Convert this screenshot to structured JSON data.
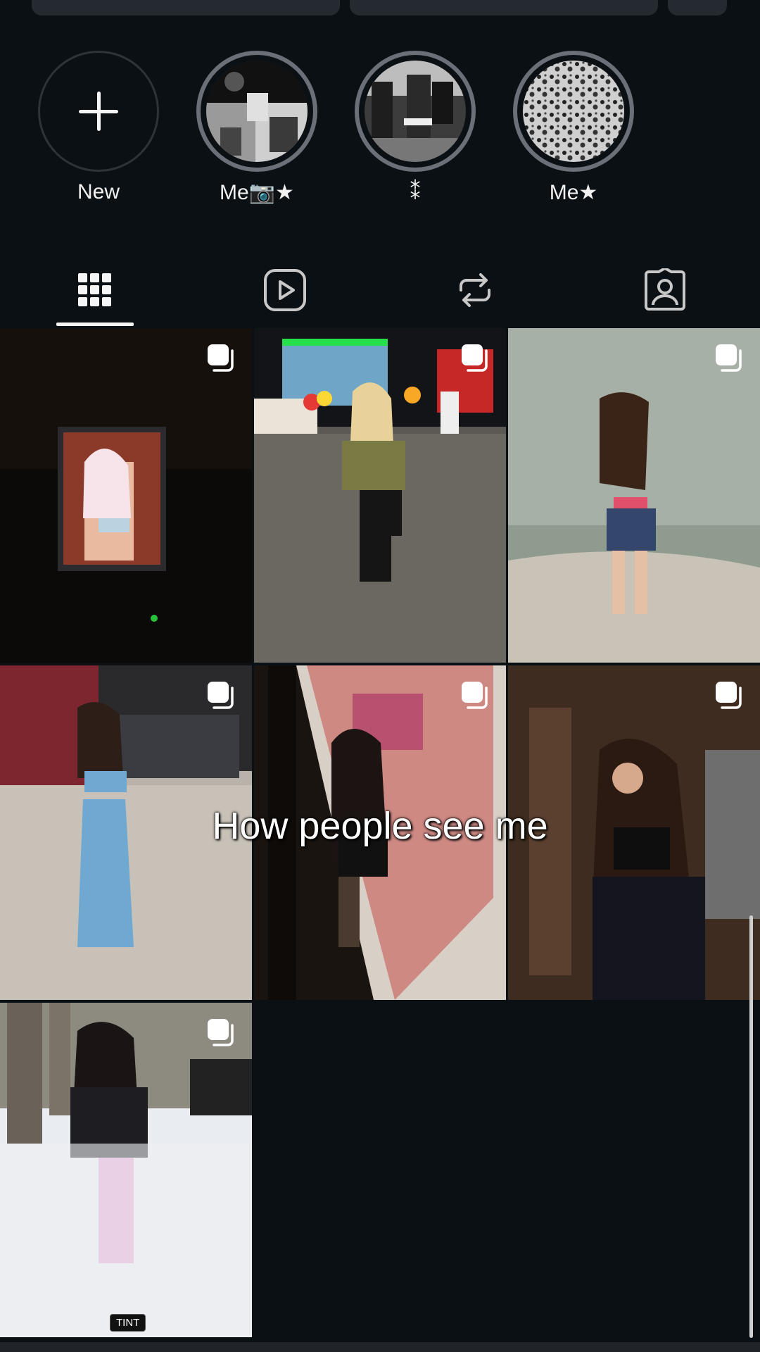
{
  "highlights": [
    {
      "label": "New"
    },
    {
      "label": "Me📷★"
    },
    {
      "label": "⁑"
    },
    {
      "label": "Me★"
    }
  ],
  "tabs": [
    {
      "icon": "grid-icon",
      "selected": true
    },
    {
      "icon": "reels-icon",
      "selected": false
    },
    {
      "icon": "reposts-icon",
      "selected": false
    },
    {
      "icon": "tagged-icon",
      "selected": false
    }
  ],
  "posts": [
    {
      "id": "post-1",
      "badge": ""
    },
    {
      "id": "post-2",
      "badge": ""
    },
    {
      "id": "post-3",
      "badge": ""
    },
    {
      "id": "post-4",
      "badge": ""
    },
    {
      "id": "post-5",
      "badge": ""
    },
    {
      "id": "post-6",
      "badge": ""
    },
    {
      "id": "post-7",
      "badge": "TINT"
    }
  ],
  "overlay": {
    "caption": "How people see me"
  },
  "colors": {
    "background": "#0b1014",
    "ring": "#6b7078",
    "text": "#f5f5f5"
  }
}
